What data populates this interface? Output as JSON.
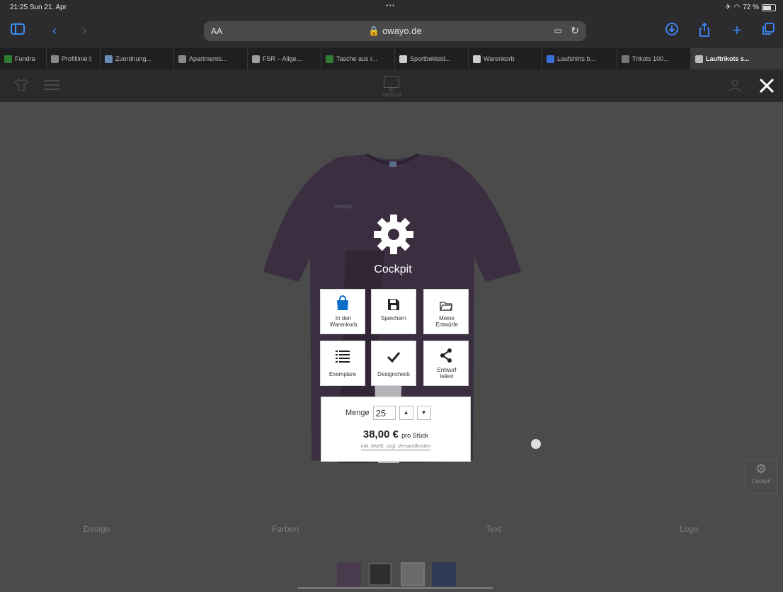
{
  "status": {
    "time": "21:25  Sun 21. Apr",
    "dots": "•••",
    "battery": "72 %"
  },
  "address": {
    "aa": "AA",
    "url": "owayo.de"
  },
  "tabs": [
    {
      "label": "Fundra",
      "color": "#2e7d32"
    },
    {
      "label": "Profillinie l:",
      "color": "#888888"
    },
    {
      "label": "Zuordnung...",
      "color": "#6a89b5"
    },
    {
      "label": "Apartments...",
      "color": "#888888"
    },
    {
      "label": "FSR – Allge...",
      "color": "#9e9e9e"
    },
    {
      "label": "Tasche aus r...",
      "color": "#2e7d32"
    },
    {
      "label": "Sportbekleid...",
      "color": "#cccccc"
    },
    {
      "label": "Warenkorb",
      "color": "#cccccc"
    },
    {
      "label": "Laufshirts b...",
      "color": "#3a6fd8"
    },
    {
      "label": "Trikots 100...",
      "color": "#777777"
    },
    {
      "label": "Lauftrikots s...",
      "color": "#bbbbbb"
    }
  ],
  "app": {
    "logo": "3D DESIGN"
  },
  "cockpit": {
    "title": "Cockpit",
    "tiles": [
      {
        "label": "In den Warenkorb",
        "icon": "shopping-bag-icon"
      },
      {
        "label": "Speichern",
        "icon": "save-icon"
      },
      {
        "label": "Meine Entwürfe",
        "icon": "folder-icon"
      },
      {
        "label": "Exemplare",
        "icon": "list-icon"
      },
      {
        "label": "Designcheck",
        "icon": "check-icon"
      },
      {
        "label": "Entwurf teilen",
        "icon": "share-icon"
      }
    ],
    "qty_label": "Menge",
    "qty_value": "25",
    "price": "38,00 €",
    "price_unit": "pro Stück",
    "vat_note": "inkl. MwSt. zzgl. Versandkosten"
  },
  "side_cockpit_label": "Cockpit",
  "bottom_nav": [
    "Design",
    "Farben",
    "Text",
    "Logo"
  ],
  "swatches": [
    "#4a3a4e",
    "#2e2e2e",
    "#6a6a6a",
    "#2e3a55"
  ],
  "colors": {
    "accent": "#3d8bfd",
    "bag_blue": "#0a6ec8"
  }
}
